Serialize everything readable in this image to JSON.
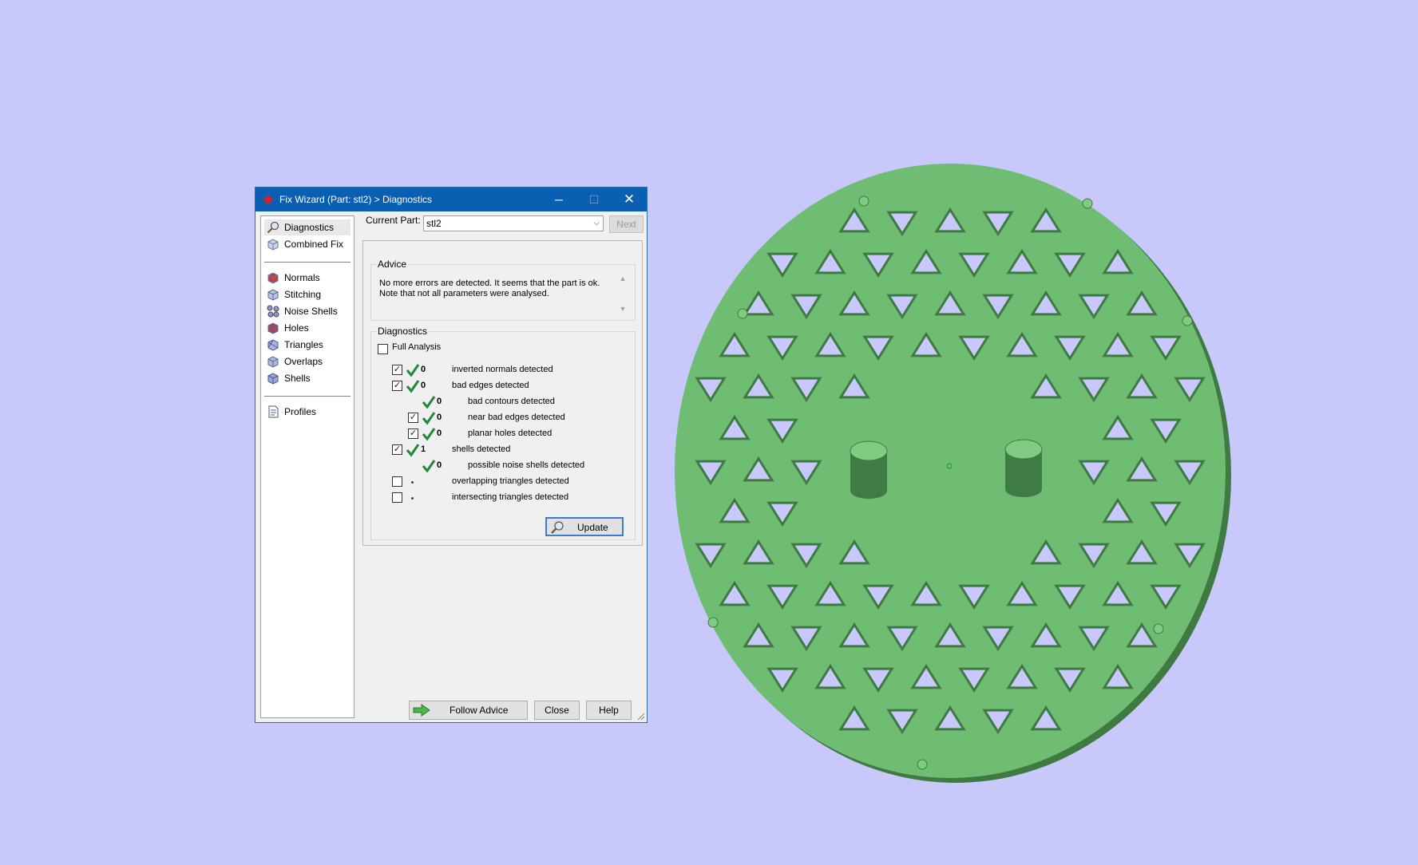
{
  "window": {
    "title": "Fix Wizard (Part: stl2) > Diagnostics",
    "minimize_glyph": "─",
    "maximize_glyph": "☐",
    "close_glyph": "✕"
  },
  "sidebar": {
    "items": [
      {
        "label": "Diagnostics",
        "icon": "magnifier-icon"
      },
      {
        "label": "Combined Fix",
        "icon": "cube-icon"
      },
      {
        "label": "Normals",
        "icon": "cube-icon"
      },
      {
        "label": "Stitching",
        "icon": "cube-icon"
      },
      {
        "label": "Noise Shells",
        "icon": "cube-icon"
      },
      {
        "label": "Holes",
        "icon": "cube-icon"
      },
      {
        "label": "Triangles",
        "icon": "cube-icon"
      },
      {
        "label": "Overlaps",
        "icon": "cube-icon"
      },
      {
        "label": "Shells",
        "icon": "cube-icon"
      },
      {
        "label": "Profiles",
        "icon": "document-icon"
      }
    ]
  },
  "current_part": {
    "label": "Current Part:",
    "value": "stl2",
    "next_label": "Next"
  },
  "advice": {
    "title": "Advice",
    "line1": "No more errors are detected. It seems that the part is ok.",
    "line2": "Note that not all parameters were analysed."
  },
  "diagnostics": {
    "title": "Diagnostics",
    "full_analysis_label": "Full Analysis",
    "rows": [
      {
        "checked": true,
        "count": "0",
        "label": "inverted normals detected"
      },
      {
        "checked": true,
        "count": "0",
        "label": "bad edges detected"
      },
      {
        "checked": null,
        "count": "0",
        "label": "bad contours detected"
      },
      {
        "checked": true,
        "count": "0",
        "label": "near bad edges detected"
      },
      {
        "checked": true,
        "count": "0",
        "label": "planar holes detected"
      },
      {
        "checked": true,
        "count": "1",
        "label": "shells detected"
      },
      {
        "checked": null,
        "count": "0",
        "label": "possible noise shells detected"
      },
      {
        "checked": false,
        "count": "",
        "label": "overlapping triangles detected"
      },
      {
        "checked": false,
        "count": "",
        "label": "intersecting triangles detected"
      }
    ],
    "update_label": "Update"
  },
  "buttons": {
    "follow_advice": "Follow Advice",
    "close": "Close",
    "help": "Help"
  },
  "colors": {
    "background": "#c9c8fb",
    "titlebar": "#0b5fb2",
    "model_green": "#6fbd72",
    "check_green": "#1f8a3a"
  }
}
